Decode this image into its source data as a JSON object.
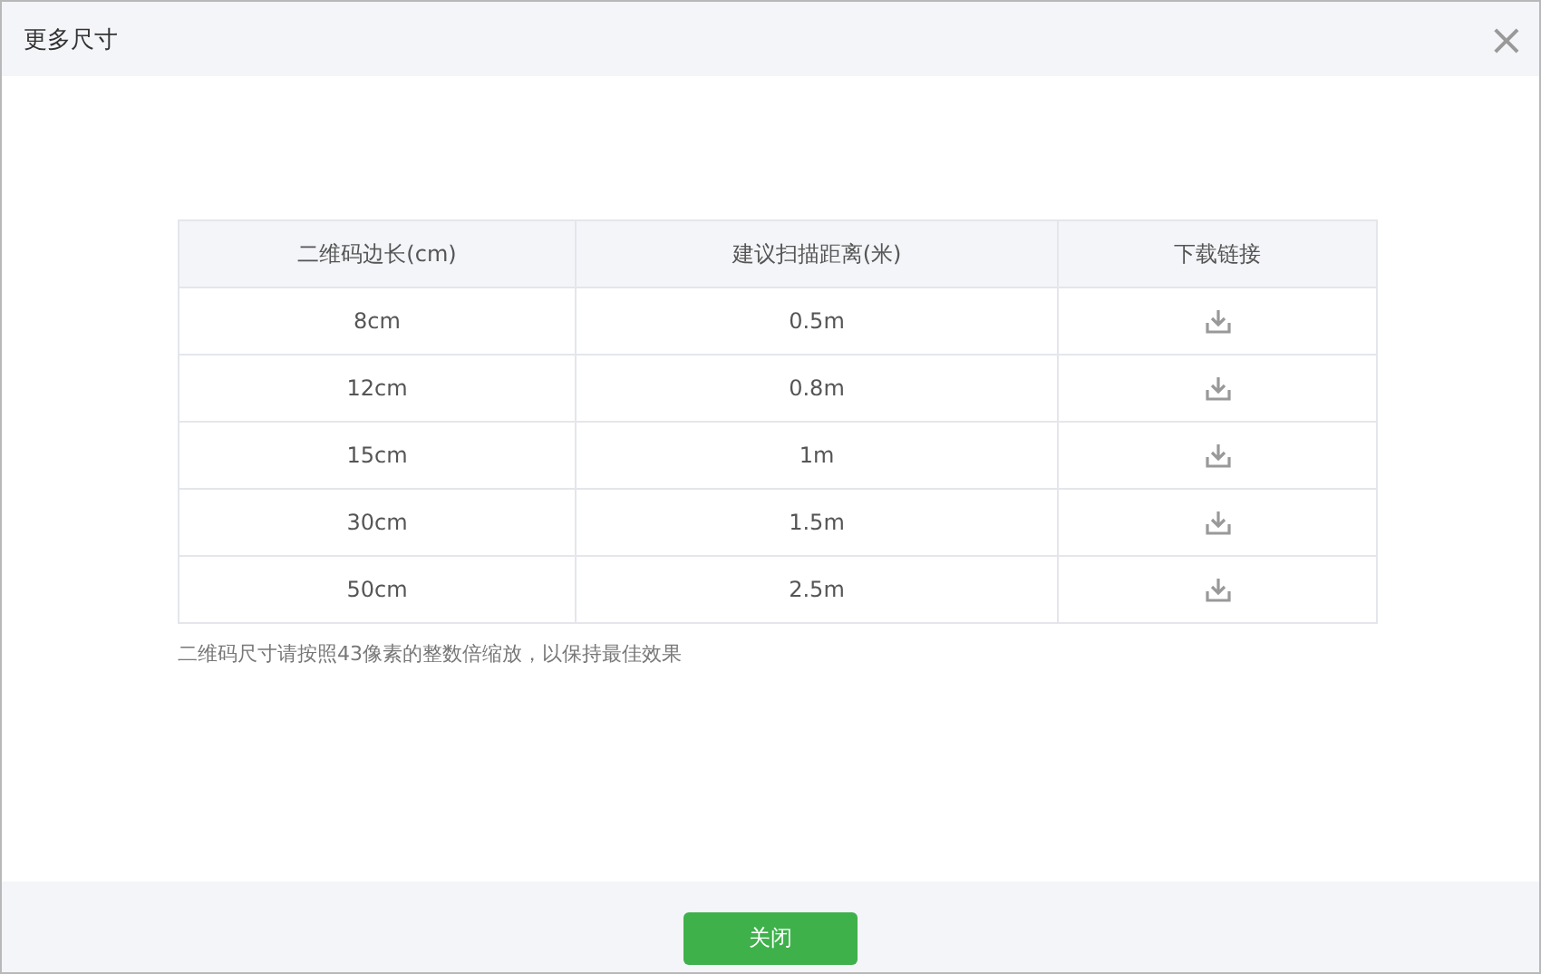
{
  "dialog": {
    "title": "更多尺寸",
    "close": "×"
  },
  "table": {
    "columns": [
      "二维码边长(cm)",
      "建议扫描距离(米)",
      "下载链接"
    ],
    "rows": [
      {
        "size": "8cm",
        "distance": "0.5m"
      },
      {
        "size": "12cm",
        "distance": "0.8m"
      },
      {
        "size": "15cm",
        "distance": "1m"
      },
      {
        "size": "30cm",
        "distance": "1.5m"
      },
      {
        "size": "50cm",
        "distance": "2.5m"
      }
    ]
  },
  "note": "二维码尺寸请按照43像素的整数倍缩放，以保持最佳效果",
  "buttons": [
    "关闭"
  ]
}
